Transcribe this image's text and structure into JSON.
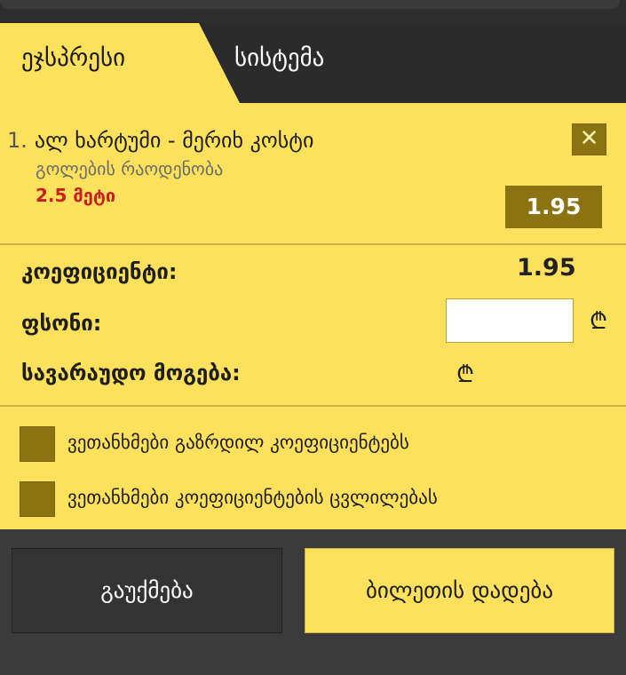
{
  "tabs": [
    {
      "label": "ეჯსპრესი"
    },
    {
      "label": "სისტემა"
    }
  ],
  "bet": {
    "number": "1.",
    "title": "ალ ხარტუმი - მერიხ კოსტი",
    "market": "გოლების რაოდენობა",
    "selection": "2.5 მეტი",
    "odd": "1.95",
    "close_glyph": "✕"
  },
  "summary": {
    "coef_label": "კოეფიციენტი:",
    "coef_value": "1.95",
    "stake_label": "ფსონი:",
    "stake_value": "",
    "win_label": "სავარაუდო მოგება:",
    "currency": "₾"
  },
  "checkboxes": [
    {
      "label": "ვეთანხმები გაზრდილ კოეფიციენტებს"
    },
    {
      "label": "ვეთანხმები კოეფიციენტების ცვლილებას"
    }
  ],
  "buttons": {
    "cancel": "გაუქმება",
    "place": "ბილეთის დადება"
  },
  "colors": {
    "accent": "#fde05b",
    "dark_gold": "#8c7312",
    "selection_red": "#c81e1e"
  }
}
